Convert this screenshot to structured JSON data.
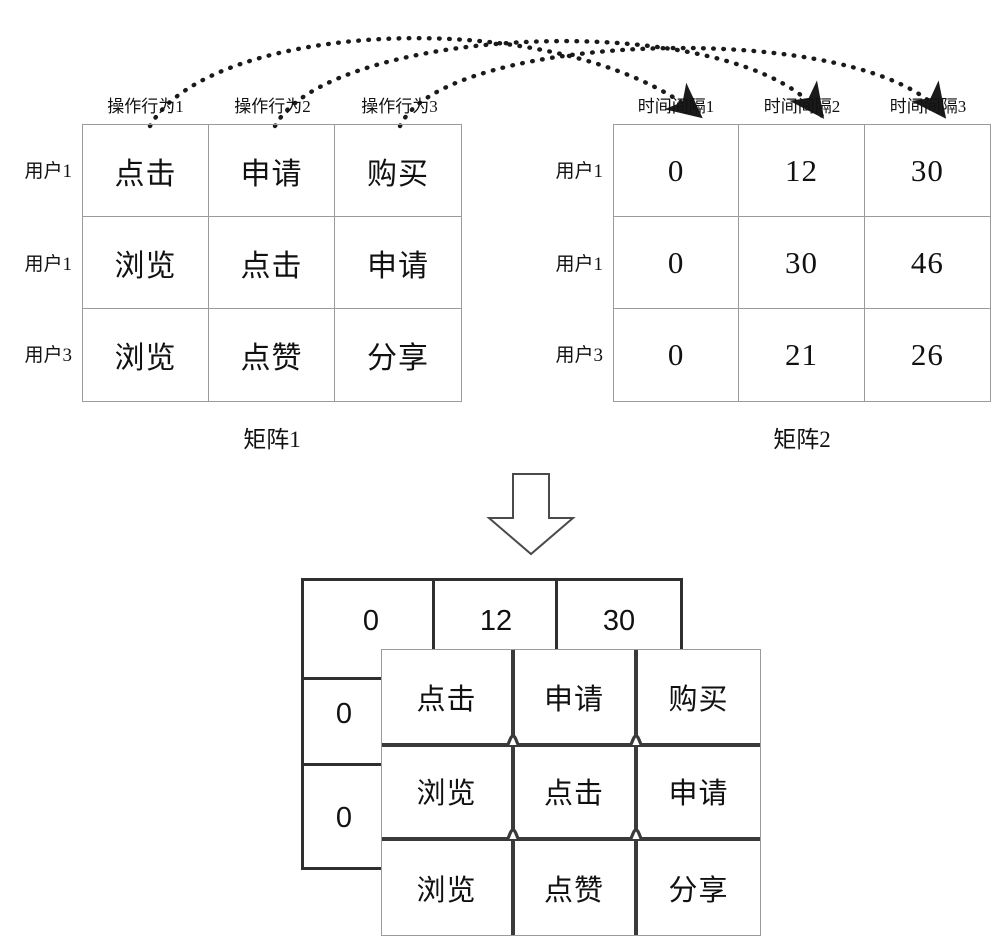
{
  "matrix1": {
    "caption": "矩阵1",
    "column_headers": [
      "操作行为1",
      "操作行为2",
      "操作行为3"
    ],
    "row_labels": [
      "用户1",
      "用户1",
      "用户3"
    ],
    "rows": [
      [
        "点击",
        "申请",
        "购买"
      ],
      [
        "浏览",
        "点击",
        "申请"
      ],
      [
        "浏览",
        "点赞",
        "分享"
      ]
    ]
  },
  "matrix2": {
    "caption": "矩阵2",
    "column_headers": [
      "时间间隔1",
      "时间间隔2",
      "时间间隔3"
    ],
    "row_labels": [
      "用户1",
      "用户1",
      "用户3"
    ],
    "rows": [
      [
        "0",
        "12",
        "30"
      ],
      [
        "0",
        "30",
        "46"
      ],
      [
        "0",
        "21",
        "26"
      ]
    ]
  },
  "merged": {
    "back_table": {
      "rows": [
        [
          "0",
          "12",
          "30"
        ],
        [
          "0",
          "",
          ""
        ],
        [
          "0",
          "",
          ""
        ]
      ]
    },
    "front_table": {
      "rows": [
        [
          "点击",
          "申请",
          "购买"
        ],
        [
          "浏览",
          "点击",
          "申请"
        ],
        [
          "浏览",
          "点赞",
          "分享"
        ]
      ]
    }
  },
  "connectors": {
    "count": 3,
    "style": "dotted-curved-arrow",
    "color": "#1a1a1a"
  },
  "merge_arrow": {
    "icon": "down-block-arrow",
    "color": "#4a4a4a"
  }
}
